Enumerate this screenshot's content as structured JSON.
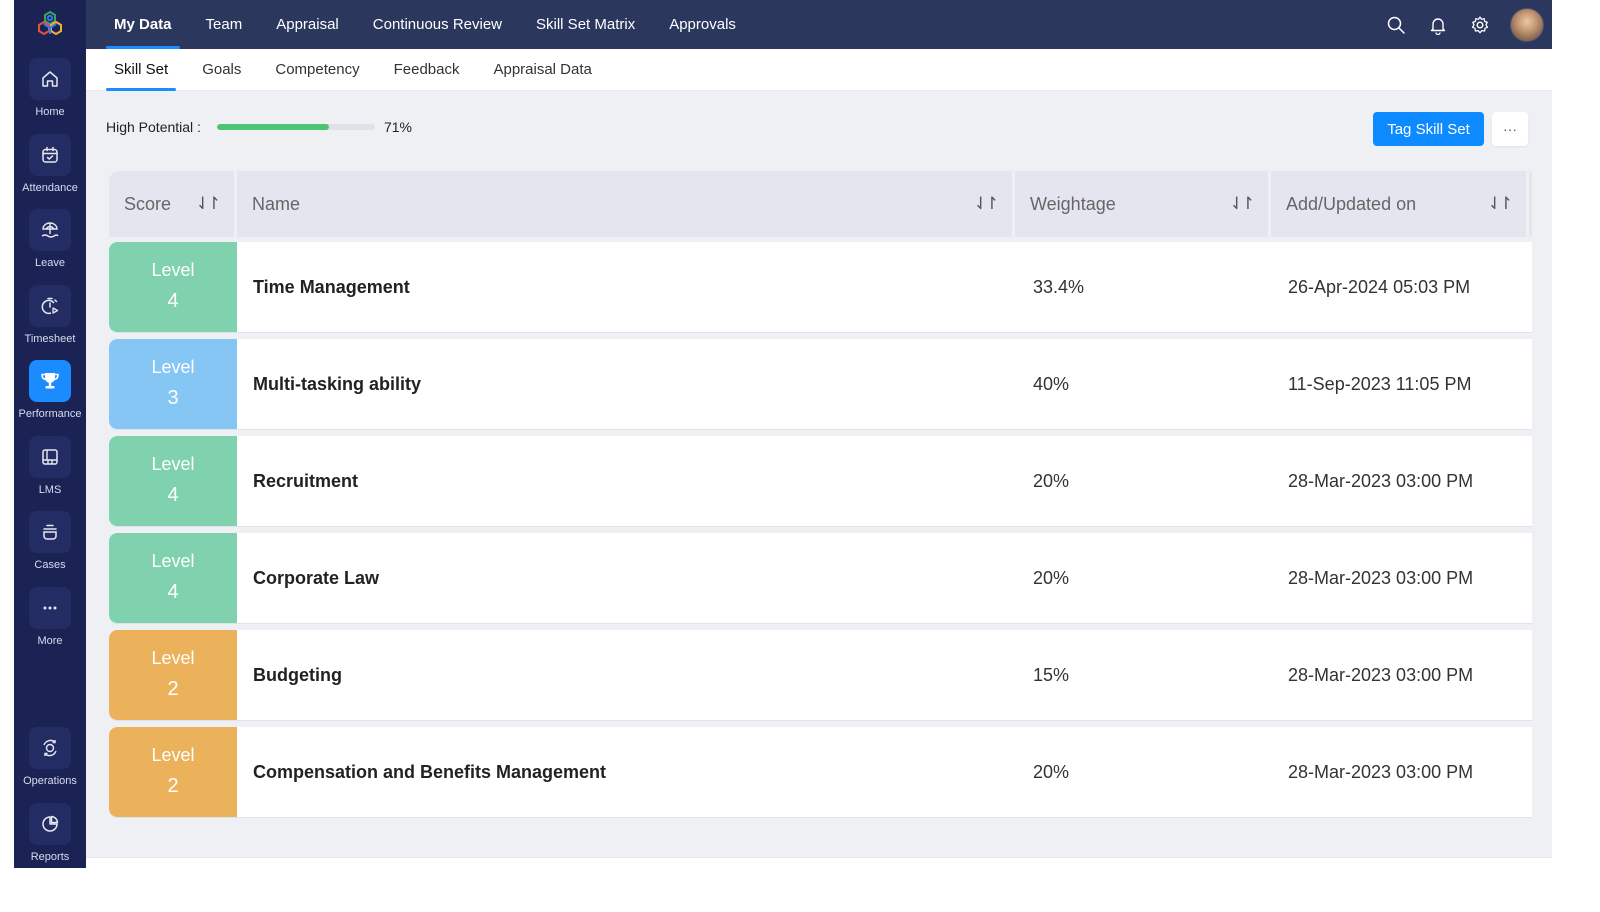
{
  "sidebar": {
    "logo": "zoho-people-logo",
    "items": [
      {
        "label": "Home",
        "icon": "home-icon",
        "active": false
      },
      {
        "label": "Attendance",
        "icon": "calendar-check-icon",
        "active": false
      },
      {
        "label": "Leave",
        "icon": "beach-umbrella-icon",
        "active": false
      },
      {
        "label": "Timesheet",
        "icon": "stopwatch-icon",
        "active": false
      },
      {
        "label": "Performance",
        "icon": "trophy-icon",
        "active": true
      },
      {
        "label": "LMS",
        "icon": "lms-icon",
        "active": false
      },
      {
        "label": "Cases",
        "icon": "cases-icon",
        "active": false
      },
      {
        "label": "More",
        "icon": "more-dots-icon",
        "active": false
      }
    ],
    "bottom_items": [
      {
        "label": "Operations",
        "icon": "operations-gear-icon"
      },
      {
        "label": "Reports",
        "icon": "pie-chart-icon"
      }
    ]
  },
  "topbar": {
    "tabs": [
      "My Data",
      "Team",
      "Appraisal",
      "Continuous Review",
      "Skill Set Matrix",
      "Approvals"
    ],
    "active_tab": "My Data",
    "icons": [
      "search-icon",
      "bell-icon",
      "gear-icon",
      "avatar"
    ]
  },
  "subtabs": {
    "tabs": [
      "Skill Set",
      "Goals",
      "Competency",
      "Feedback",
      "Appraisal Data"
    ],
    "active_tab": "Skill Set"
  },
  "potential": {
    "label": "High Potential :",
    "value_text": "71%",
    "percent": 71
  },
  "actions": {
    "tag_button": "Tag Skill Set",
    "more_button": "···"
  },
  "table": {
    "columns": [
      "Score",
      "Name",
      "Weightage",
      "Add/Updated on"
    ],
    "level_word": "Level",
    "level_colors": {
      "4": "#80d1ae",
      "3": "#86c6f4",
      "2": "#ebb25b"
    },
    "rows": [
      {
        "level": "4",
        "name": "Time Management",
        "weightage": "33.4%",
        "updated": "26-Apr-2024 05:03 PM"
      },
      {
        "level": "3",
        "name": "Multi-tasking ability",
        "weightage": "40%",
        "updated": "11-Sep-2023 11:05 PM"
      },
      {
        "level": "4",
        "name": "Recruitment",
        "weightage": "20%",
        "updated": "28-Mar-2023 03:00 PM"
      },
      {
        "level": "4",
        "name": "Corporate Law",
        "weightage": "20%",
        "updated": "28-Mar-2023 03:00 PM"
      },
      {
        "level": "2",
        "name": "Budgeting",
        "weightage": "15%",
        "updated": "28-Mar-2023 03:00 PM"
      },
      {
        "level": "2",
        "name": "Compensation and Benefits Management",
        "weightage": "20%",
        "updated": "28-Mar-2023 03:00 PM"
      }
    ]
  },
  "colors": {
    "sidebar_bg": "#1b2354",
    "topbar_bg": "#2c375e",
    "accent": "#1a8cff",
    "progress": "#4cc474"
  }
}
